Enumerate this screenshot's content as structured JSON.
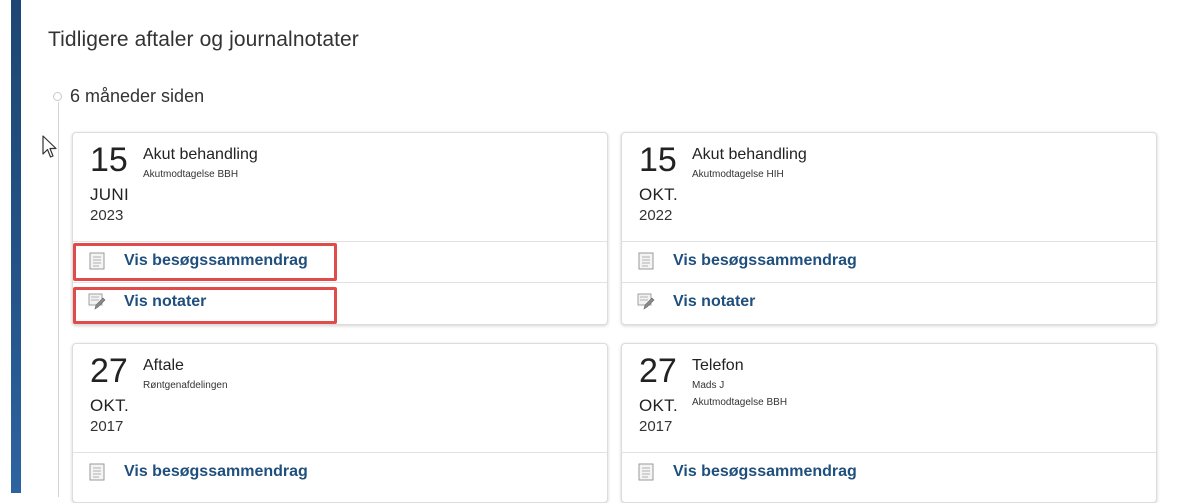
{
  "page": {
    "section_title": "Tidligere aftaler og journalnotater",
    "period_label": "6 måneder siden"
  },
  "cards": [
    {
      "day": "15",
      "month": "JUNI",
      "year": "2023",
      "type": "Akut behandling",
      "sub1": "Akutmodtagelse BBH",
      "sub2": "",
      "summary_label": "Vis besøgssammendrag",
      "notes_label": "Vis notater"
    },
    {
      "day": "15",
      "month": "OKT.",
      "year": "2022",
      "type": "Akut behandling",
      "sub1": "Akutmodtagelse HIH",
      "sub2": "",
      "summary_label": "Vis besøgssammendrag",
      "notes_label": "Vis notater"
    },
    {
      "day": "27",
      "month": "OKT.",
      "year": "2017",
      "type": "Aftale",
      "sub1": "Røntgenafdelingen",
      "sub2": "",
      "summary_label": "Vis besøgssammendrag"
    },
    {
      "day": "27",
      "month": "OKT.",
      "year": "2017",
      "type": "Telefon",
      "sub1": "Mads J",
      "sub2": "Akutmodtagelse BBH",
      "summary_label": "Vis besøgssammendrag"
    }
  ],
  "icons": {
    "summary": "document-icon",
    "notes": "note-pencil-icon"
  },
  "colors": {
    "link": "#1f4f7d",
    "highlight": "#e04b4b",
    "side_bar": "#235387"
  }
}
